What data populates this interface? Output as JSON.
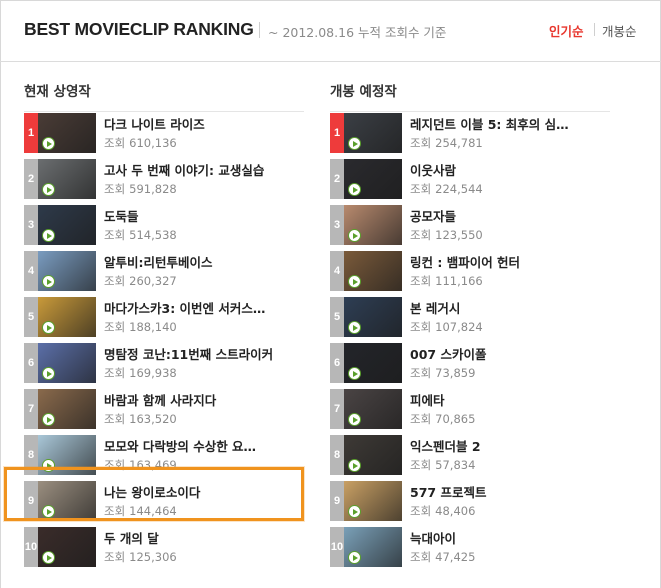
{
  "header": {
    "title": "BEST MOVIECLIP RANKING",
    "subtitle": "~ 2012.08.16 누적 조회수 기준",
    "tabs": [
      {
        "label": "인기순",
        "active": true
      },
      {
        "label": "개봉순",
        "active": false
      }
    ]
  },
  "colors": {
    "accent": "#e8362d",
    "rank_top": "#ee3b3b",
    "rank_default": "#b7b7b7",
    "play_icon": "#5aa02c",
    "highlight": "#f0931e"
  },
  "views_label": "조회",
  "now_showing": {
    "heading": "현재 상영작",
    "items": [
      {
        "rank": "1",
        "title": "다크 나이트 라이즈",
        "views": "610,136",
        "thumb": "#4a3c36"
      },
      {
        "rank": "2",
        "title": "고사 두 번째 이야기: 교생실습",
        "views": "591,828",
        "thumb": "#6b6e70"
      },
      {
        "rank": "3",
        "title": "도둑들",
        "views": "514,538",
        "thumb": "#2e3a4a"
      },
      {
        "rank": "4",
        "title": "알투비:리턴투베이스",
        "views": "260,327",
        "thumb": "#7a9cc0"
      },
      {
        "rank": "5",
        "title": "마다가스카3: 이번엔 서커스…",
        "views": "188,140",
        "thumb": "#c99a3a"
      },
      {
        "rank": "6",
        "title": "명탐정 코난:11번째 스트라이커",
        "views": "169,938",
        "thumb": "#5b6fa8"
      },
      {
        "rank": "7",
        "title": "바람과 함께 사라지다",
        "views": "163,520",
        "thumb": "#8a6a4c"
      },
      {
        "rank": "8",
        "title": "모모와 다락방의 수상한 요…",
        "views": "163,469",
        "thumb": "#a9c7d8"
      },
      {
        "rank": "9",
        "title": "나는 왕이로소이다",
        "views": "144,464",
        "thumb": "#9b8f80"
      },
      {
        "rank": "10",
        "title": "두 개의 달",
        "views": "125,306",
        "thumb": "#3a2c2a"
      }
    ]
  },
  "upcoming": {
    "heading": "개봉 예정작",
    "items": [
      {
        "rank": "1",
        "title": "레지던트 이블 5: 최후의 심…",
        "views": "254,781",
        "thumb": "#3b3f45"
      },
      {
        "rank": "2",
        "title": "이웃사람",
        "views": "224,544",
        "thumb": "#2a2a2e"
      },
      {
        "rank": "3",
        "title": "공모자들",
        "views": "123,550",
        "thumb": "#b88a6e"
      },
      {
        "rank": "4",
        "title": "링컨 : 뱀파이어 헌터",
        "views": "111,166",
        "thumb": "#7a5a3a"
      },
      {
        "rank": "5",
        "title": "본 레거시",
        "views": "107,824",
        "thumb": "#2e3e54"
      },
      {
        "rank": "6",
        "title": "007 스카이폴",
        "views": "73,859",
        "thumb": "#23252a"
      },
      {
        "rank": "7",
        "title": "피에타",
        "views": "70,865",
        "thumb": "#4a4444"
      },
      {
        "rank": "8",
        "title": "익스펜더블 2",
        "views": "57,834",
        "thumb": "#3e3a36"
      },
      {
        "rank": "9",
        "title": "577 프로젝트",
        "views": "48,406",
        "thumb": "#c9a064"
      },
      {
        "rank": "10",
        "title": "늑대아이",
        "views": "47,425",
        "thumb": "#7aa0b8"
      }
    ]
  }
}
